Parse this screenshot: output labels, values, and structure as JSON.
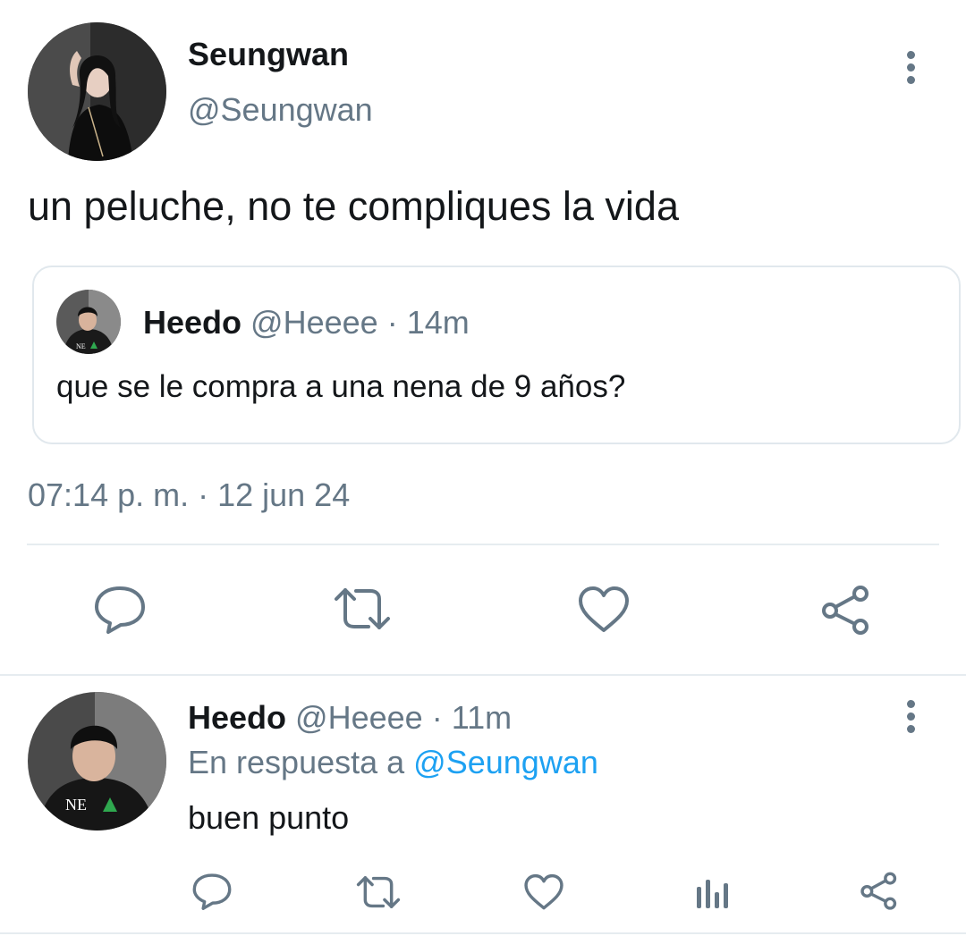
{
  "main_tweet": {
    "author_name": "Seungwan",
    "author_handle": "@Seungwan",
    "text": "un peluche, no te compliques la vida",
    "timestamp": "07:14 p. m. · 12 jun 24",
    "quoted": {
      "author_name": "Heedo",
      "author_handle": "@Heeee",
      "separator": "·",
      "time": "14m",
      "text": "que se le compra a una nena de 9 años?"
    },
    "actions": [
      "reply-icon",
      "retweet-icon",
      "like-icon",
      "share-icon"
    ]
  },
  "reply_tweet": {
    "author_name": "Heedo",
    "author_handle": "@Heeee",
    "separator": "·",
    "time": "11m",
    "reply_prefix": "En respuesta a",
    "reply_to": "@Seungwan",
    "text": "buen punto",
    "actions": [
      "reply-icon",
      "retweet-icon",
      "like-icon",
      "analytics-icon",
      "share-icon"
    ]
  },
  "colors": {
    "text": "#14171a",
    "muted": "#657786",
    "link": "#1da1f2",
    "divider": "#e6ecf0"
  }
}
